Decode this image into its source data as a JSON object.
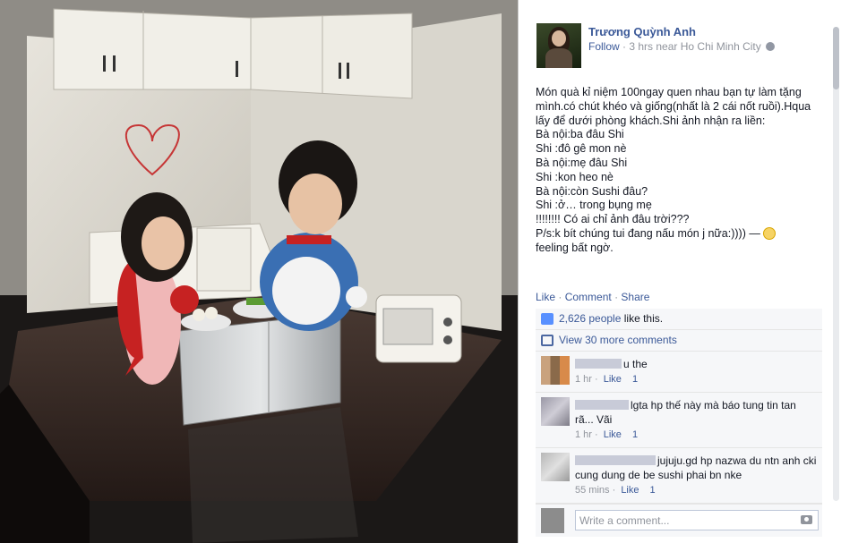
{
  "post": {
    "author": "Trương Quỳnh Anh",
    "follow_label": "Follow",
    "meta_sep": "·",
    "time_location": "3 hrs near Ho Chi Minh City",
    "privacy_icon": "globe-icon",
    "text_lines": [
      "Món quà kỉ niệm 100ngay quen nhau bạn tự làm tặng",
      "mình.có chút khéo và giống(nhất là 2 cái nốt ruồi).Hqua",
      "lấy để dưới phòng khách.Shi ảnh nhận ra liền:",
      "Bà nội:ba đâu Shi",
      "Shi :đô gê mon nè",
      "Bà nội:mẹ đâu Shi",
      "Shi :kon heo nè",
      "Bà nội:còn Sushi đâu?",
      "Shi :ở… trong bụng mẹ",
      "!!!!!!!! Có ai chỉ ảnh đâu trời???",
      "P/s:k bít chúng tui đang nấu món j nữa:)))) —"
    ],
    "feeling_text": "feeling bất ngờ.",
    "feeling_icon": "smiley-icon"
  },
  "actions": {
    "like": "Like",
    "comment": "Comment",
    "share": "Share",
    "sep": "·"
  },
  "likes": {
    "count": "2,626 people",
    "suffix": " like this."
  },
  "view_more": "View 30 more comments",
  "comments": [
    {
      "text": "u the",
      "time": "1 hr",
      "like": "Like",
      "likes": "1"
    },
    {
      "text": "lgta hp thế này mà báo tung tin tan rã... Vãi",
      "time": "1 hr",
      "like": "Like",
      "likes": "1"
    },
    {
      "text": "jujuju.gd hp nazwa du ntn anh cki cung dung de be sushi phai bn nke",
      "time": "55 mins",
      "like": "Like",
      "likes": "1"
    }
  ],
  "composer": {
    "placeholder": "Write a comment..."
  },
  "colors": {
    "link": "#3b5998",
    "muted": "#90949c",
    "panel": "#f6f7f9"
  }
}
